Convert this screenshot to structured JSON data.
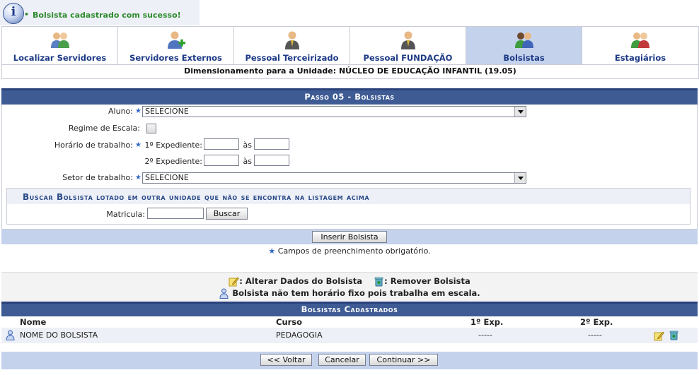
{
  "message": {
    "text": "Bolsista cadastrado com sucesso!"
  },
  "tabs": [
    {
      "label": "Localizar Servidores",
      "icon": "people-search-icon",
      "active": false
    },
    {
      "label": "Servidores Externos",
      "icon": "person-add-icon",
      "active": false
    },
    {
      "label": "Pessoal Terceirizado",
      "icon": "person-suit-icon",
      "active": false
    },
    {
      "label": "Pessoal FUNDAÇÃO",
      "icon": "person-suit-icon",
      "active": false
    },
    {
      "label": "Bolsistas",
      "icon": "people-icon",
      "active": true
    },
    {
      "label": "Estagiários",
      "icon": "people-icon",
      "active": false
    }
  ],
  "dimensionamento": "Dimensionamento para a Unidade: NÚCLEO DE EDUCAÇÃO INFANTIL (19.05)",
  "form": {
    "title": "Passo 05 - Bolsistas",
    "aluno_label": "Aluno:",
    "aluno_value": "SELECIONE",
    "regime_label": "Regime de Escala:",
    "horario_label": "Horário de trabalho:",
    "exp1_label": "1º Expediente:",
    "exp2_label": "2º Expediente:",
    "as_label": "às",
    "setor_label": "Setor de trabalho:",
    "setor_value": "SELECIONE",
    "buscar_title": "Buscar Bolsista lotado em outra unidade que não se encontra na listagem acima",
    "matricula_label": "Matricula:",
    "buscar_button": "Buscar",
    "inserir_button": "Inserir Bolsista",
    "obrigatorio": "Campos de preenchimento obrigatório."
  },
  "legend": {
    "alterar": ": Alterar Dados do Bolsista",
    "remover": ": Remover Bolsista",
    "escala": "Bolsista não tem horário fixo pois trabalha em escala."
  },
  "table": {
    "caption": "Bolsistas Cadastrados",
    "headers": {
      "nome": "Nome",
      "curso": "Curso",
      "exp1": "1º Exp.",
      "exp2": "2º Exp."
    },
    "rows": [
      {
        "nome": "NOME DO BOLSISTA",
        "curso": "PEDAGOGIA",
        "exp1": "-----",
        "exp2": "-----"
      }
    ]
  },
  "buttons": {
    "voltar": "<< Voltar",
    "cancelar": "Cancelar",
    "continuar": "Continuar >>"
  },
  "colors": {
    "header_blue": "#3e5b94",
    "light_blue": "#c4d2ec",
    "link_blue": "#1d3a86",
    "success_green": "#2e8b2e"
  }
}
